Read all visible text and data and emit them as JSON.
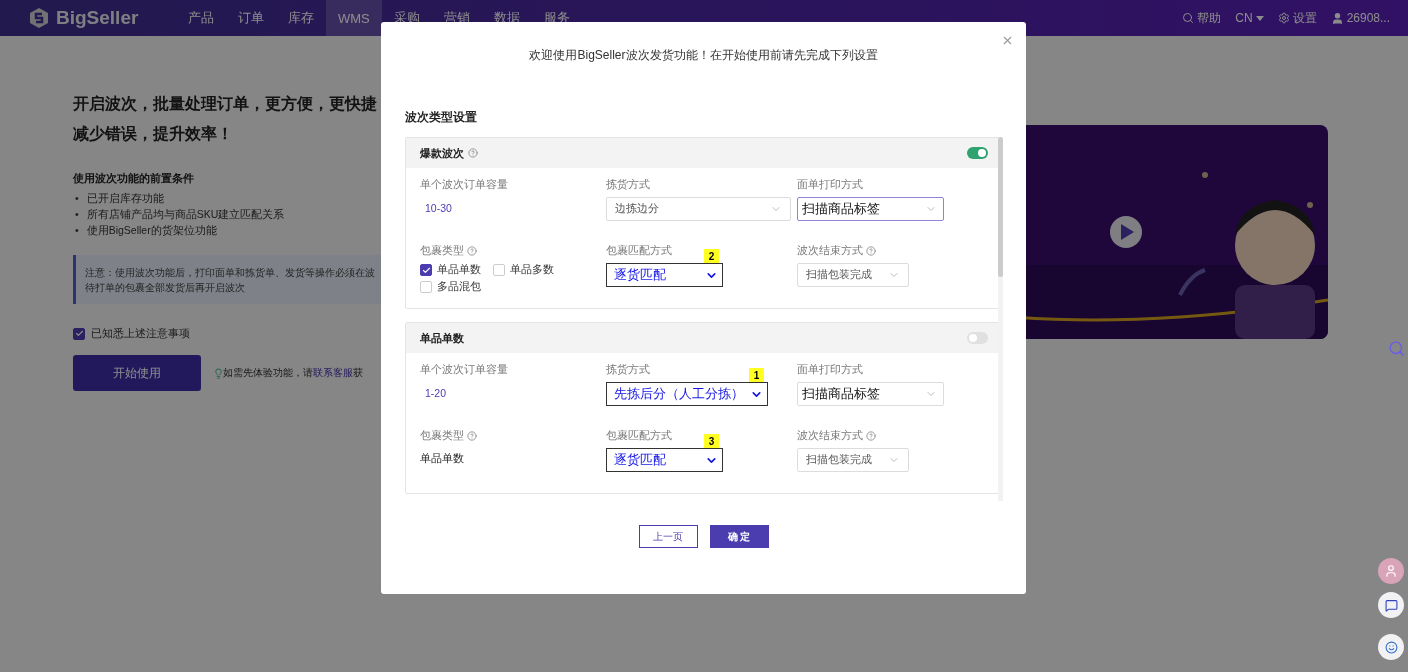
{
  "nav": {
    "logo": "BigSeller",
    "items": [
      {
        "label": "产品",
        "selected": false
      },
      {
        "label": "订单",
        "selected": false
      },
      {
        "label": "库存",
        "selected": false
      },
      {
        "label": "WMS",
        "selected": true
      },
      {
        "label": "采购",
        "selected": false
      },
      {
        "label": "营销",
        "selected": false
      },
      {
        "label": "数据",
        "selected": false
      },
      {
        "label": "服务",
        "selected": false
      }
    ],
    "help": "帮助",
    "language": "CN",
    "settings": "设置",
    "user": "26908..."
  },
  "intro": {
    "headline": [
      "开启波次，批量处理订单，更方便，更快捷",
      "减少错误，提升效率！"
    ],
    "prereq_title": "使用波次功能的前置条件",
    "prereqs": [
      {
        "bullet": "•",
        "text": "已开启库存功能"
      },
      {
        "bullet": "•",
        "text": "所有店铺产品均与商品SKU建立匹配关系"
      },
      {
        "bullet": "•",
        "text": "使用BigSeller的货架位功能"
      }
    ],
    "notice": [
      "注意：使用波次功能后，打印面单和拣货单、发货等操作必须在波",
      "待打单的包裹全部发货后再开启波次"
    ],
    "acknowledge": {
      "label": "已知悉上述注意事项",
      "checked": true
    },
    "start_button": "开始使用",
    "tip": {
      "before": "如需先体验功能，请",
      "link": "联系客服",
      "after": "获"
    }
  },
  "modal": {
    "title": "欢迎使用BigSeller波次发货功能！在开始使用前请先完成下列设置",
    "section_title": "波次类型设置",
    "cards": [
      {
        "title": "爆款波次",
        "help": true,
        "on": true,
        "fields": [
          {
            "kind": "range",
            "label": "单个波次订单容量",
            "value": "10-30"
          },
          {
            "kind": "select",
            "label": "拣货方式",
            "value": "边拣边分"
          },
          {
            "kind": "select",
            "focused": true,
            "label": "面单打印方式",
            "value": "扫描商品标签"
          },
          {
            "kind": "checks",
            "label": "包裹类型",
            "help": true,
            "options": [
              {
                "label": "单品单数",
                "checked": true
              },
              {
                "label": "单品多数",
                "checked": false
              },
              {
                "label": "多品混包",
                "checked": false
              }
            ]
          },
          {
            "kind": "select",
            "label": "包裹匹配方式",
            "value": "逐货匹配",
            "marker": "2"
          },
          {
            "kind": "select",
            "label": "波次结束方式",
            "help": true,
            "value": "扫描包装完成"
          }
        ]
      },
      {
        "title": "单品单数",
        "on": false,
        "fields": [
          {
            "kind": "range",
            "label": "单个波次订单容量",
            "value": "1-20"
          },
          {
            "kind": "select",
            "label": "拣货方式",
            "value": "先拣后分（人工分拣）",
            "marker": "1"
          },
          {
            "kind": "select",
            "focused": false,
            "label": "面单打印方式",
            "value": "扫描商品标签"
          },
          {
            "kind": "text",
            "label": "包裹类型",
            "help": true,
            "value": "单品单数"
          },
          {
            "kind": "select",
            "label": "包裹匹配方式",
            "value": "逐货匹配",
            "marker": "3"
          },
          {
            "kind": "select",
            "label": "波次结束方式",
            "help": true,
            "value": "扫描包装完成"
          }
        ]
      }
    ],
    "prev_button": "上一页",
    "confirm_button": "确 定"
  }
}
